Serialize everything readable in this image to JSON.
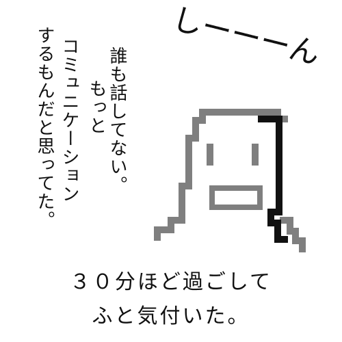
{
  "narration_lines": [
    "誰も話してない。",
    "もっと",
    "コミュニケーション",
    "するもんだと思ってた。"
  ],
  "sound_effect": "しーーーん",
  "caption_lines": [
    "３０分ほど過ごして",
    "ふと気付いた。"
  ],
  "colors": {
    "ink": "#111111",
    "figure_grey": "#7f7f7f",
    "background": "#ffffff"
  }
}
